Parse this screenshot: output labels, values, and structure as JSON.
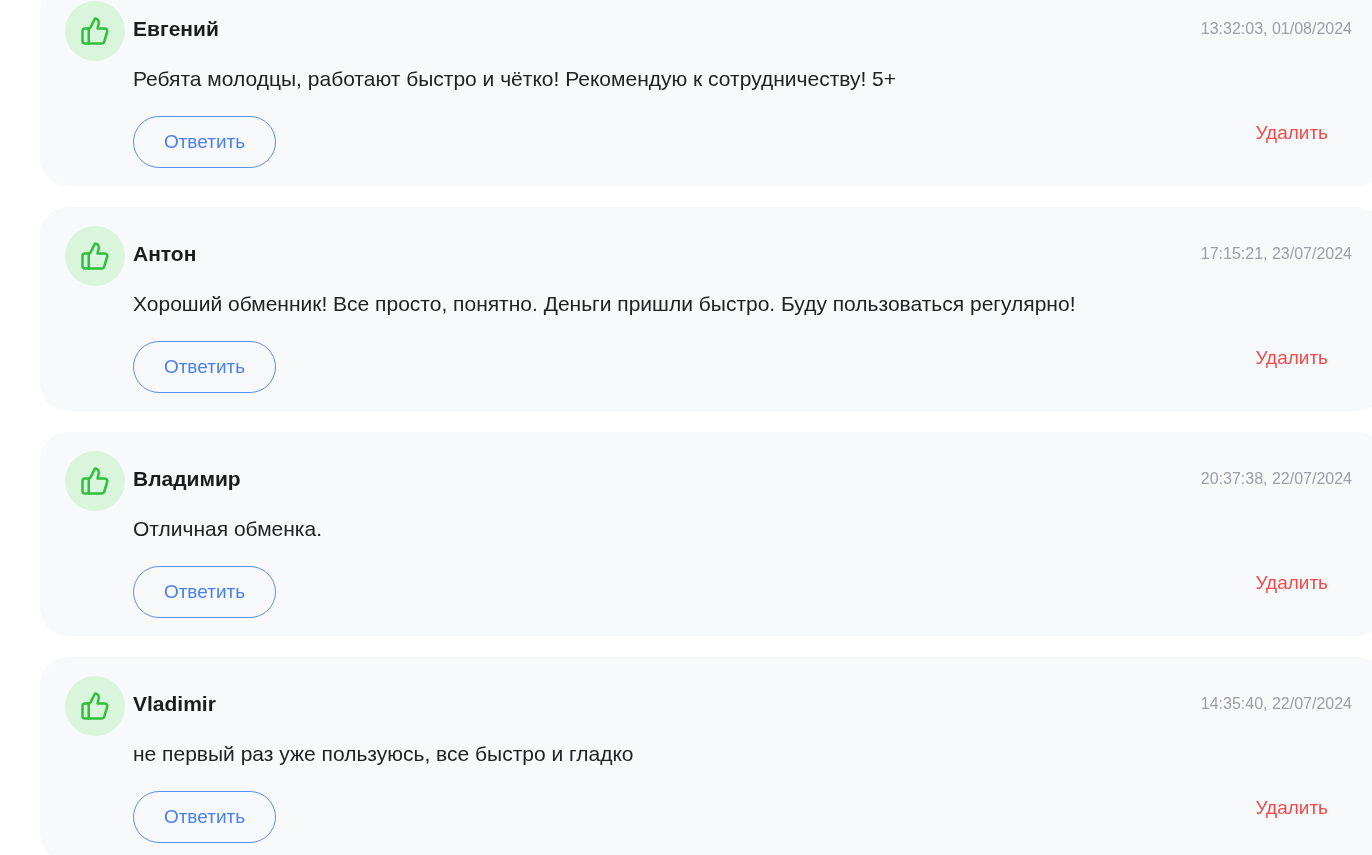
{
  "reviews": [
    {
      "author": "Евгений",
      "time": "13:32:03, 01/08/2024",
      "text": "Ребята молодцы, работают быстро и чётко! Рекомендую к сотрудничеству! 5+",
      "reply": "Ответить",
      "delete": "Удалить"
    },
    {
      "author": "Антон",
      "time": "17:15:21, 23/07/2024",
      "text": "Хороший обменник! Все просто, понятно. Деньги пришли быстро. Буду пользоваться регулярно!",
      "reply": "Ответить",
      "delete": "Удалить"
    },
    {
      "author": "Владимир",
      "time": "20:37:38, 22/07/2024",
      "text": "Отличная обменка.",
      "reply": "Ответить",
      "delete": "Удалить"
    },
    {
      "author": "Vladimir",
      "time": "14:35:40, 22/07/2024",
      "text": "не первый раз уже пользуюсь, все быстро и гладко",
      "reply": "Ответить",
      "delete": "Удалить"
    }
  ]
}
